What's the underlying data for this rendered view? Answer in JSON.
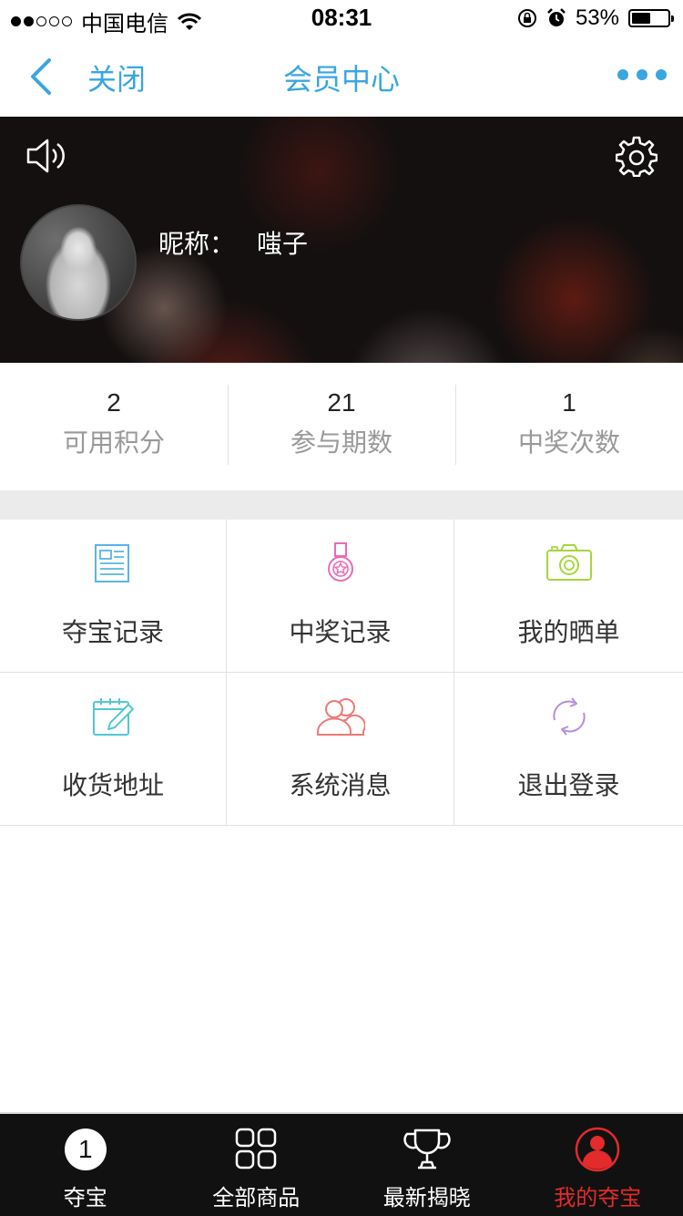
{
  "status_bar": {
    "carrier": "中国电信",
    "time": "08:31",
    "battery": "53%",
    "battery_level": 0.53,
    "signal_bars_filled": 2,
    "signal_bars_total": 5
  },
  "nav": {
    "close_label": "关闭",
    "title": "会员中心",
    "accent_color": "#39a6e0"
  },
  "profile": {
    "nickname_label": "昵称：",
    "nickname": "嗤子"
  },
  "stats": [
    {
      "value": "2",
      "label": "可用积分"
    },
    {
      "value": "21",
      "label": "参与期数"
    },
    {
      "value": "1",
      "label": "中奖次数"
    }
  ],
  "menu": [
    {
      "label": "夺宝记录",
      "icon": "newspaper-icon",
      "color": "#5ab4e8"
    },
    {
      "label": "中奖记录",
      "icon": "medal-icon",
      "color": "#e86bb4"
    },
    {
      "label": "我的晒单",
      "icon": "camera-icon",
      "color": "#a6d63c"
    },
    {
      "label": "收货地址",
      "icon": "notepad-icon",
      "color": "#52c8d0"
    },
    {
      "label": "系统消息",
      "icon": "users-icon",
      "color": "#ec7a76"
    },
    {
      "label": "退出登录",
      "icon": "refresh-icon",
      "color": "#b48de0"
    }
  ],
  "tabbar": {
    "tabs": [
      {
        "label": "夺宝",
        "icon": "badge-one-icon",
        "badge": "1"
      },
      {
        "label": "全部商品",
        "icon": "grid-icon"
      },
      {
        "label": "最新揭晓",
        "icon": "trophy-icon"
      },
      {
        "label": "我的夺宝",
        "icon": "user-icon",
        "active": true
      }
    ],
    "active_color": "#e32b2b"
  }
}
